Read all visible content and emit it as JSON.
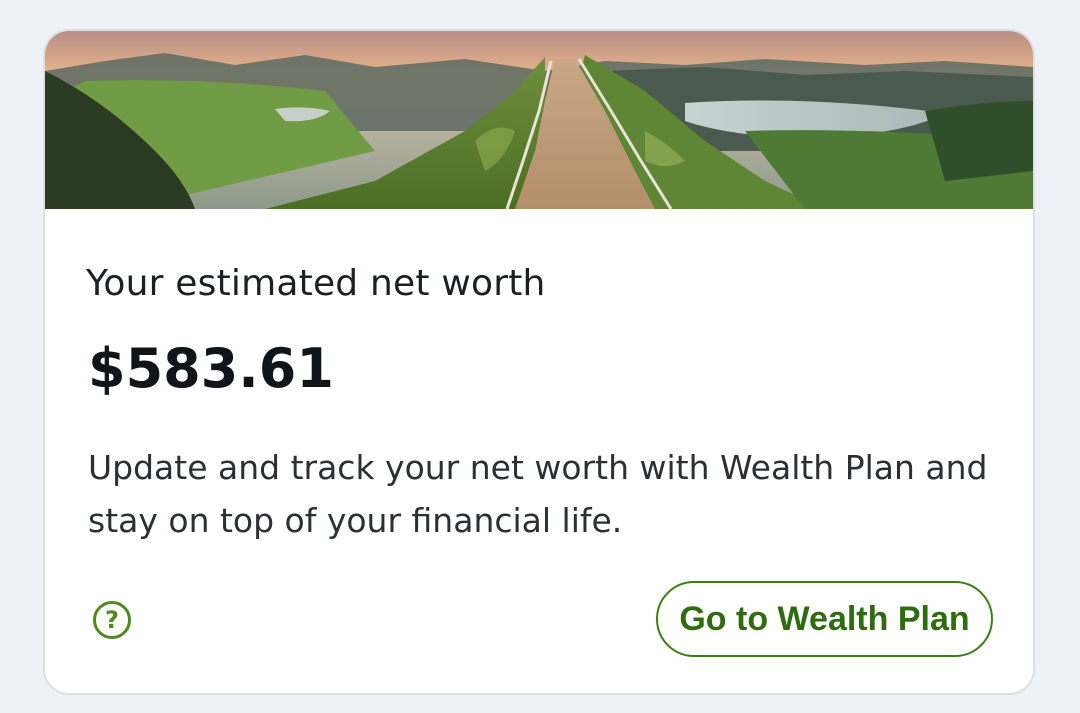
{
  "card": {
    "title": "Your estimated net worth",
    "amount": "$583.61",
    "description": "Update and track your net worth with Wealth Plan and stay on top of your financial life.",
    "help_icon_glyph": "?",
    "cta_label": "Go to Wealth Plan"
  },
  "colors": {
    "accent_green": "#4e8a1c",
    "page_background": "#eef1f6",
    "card_background": "#ffffff"
  },
  "icons": {
    "help": "question-circle-icon"
  }
}
